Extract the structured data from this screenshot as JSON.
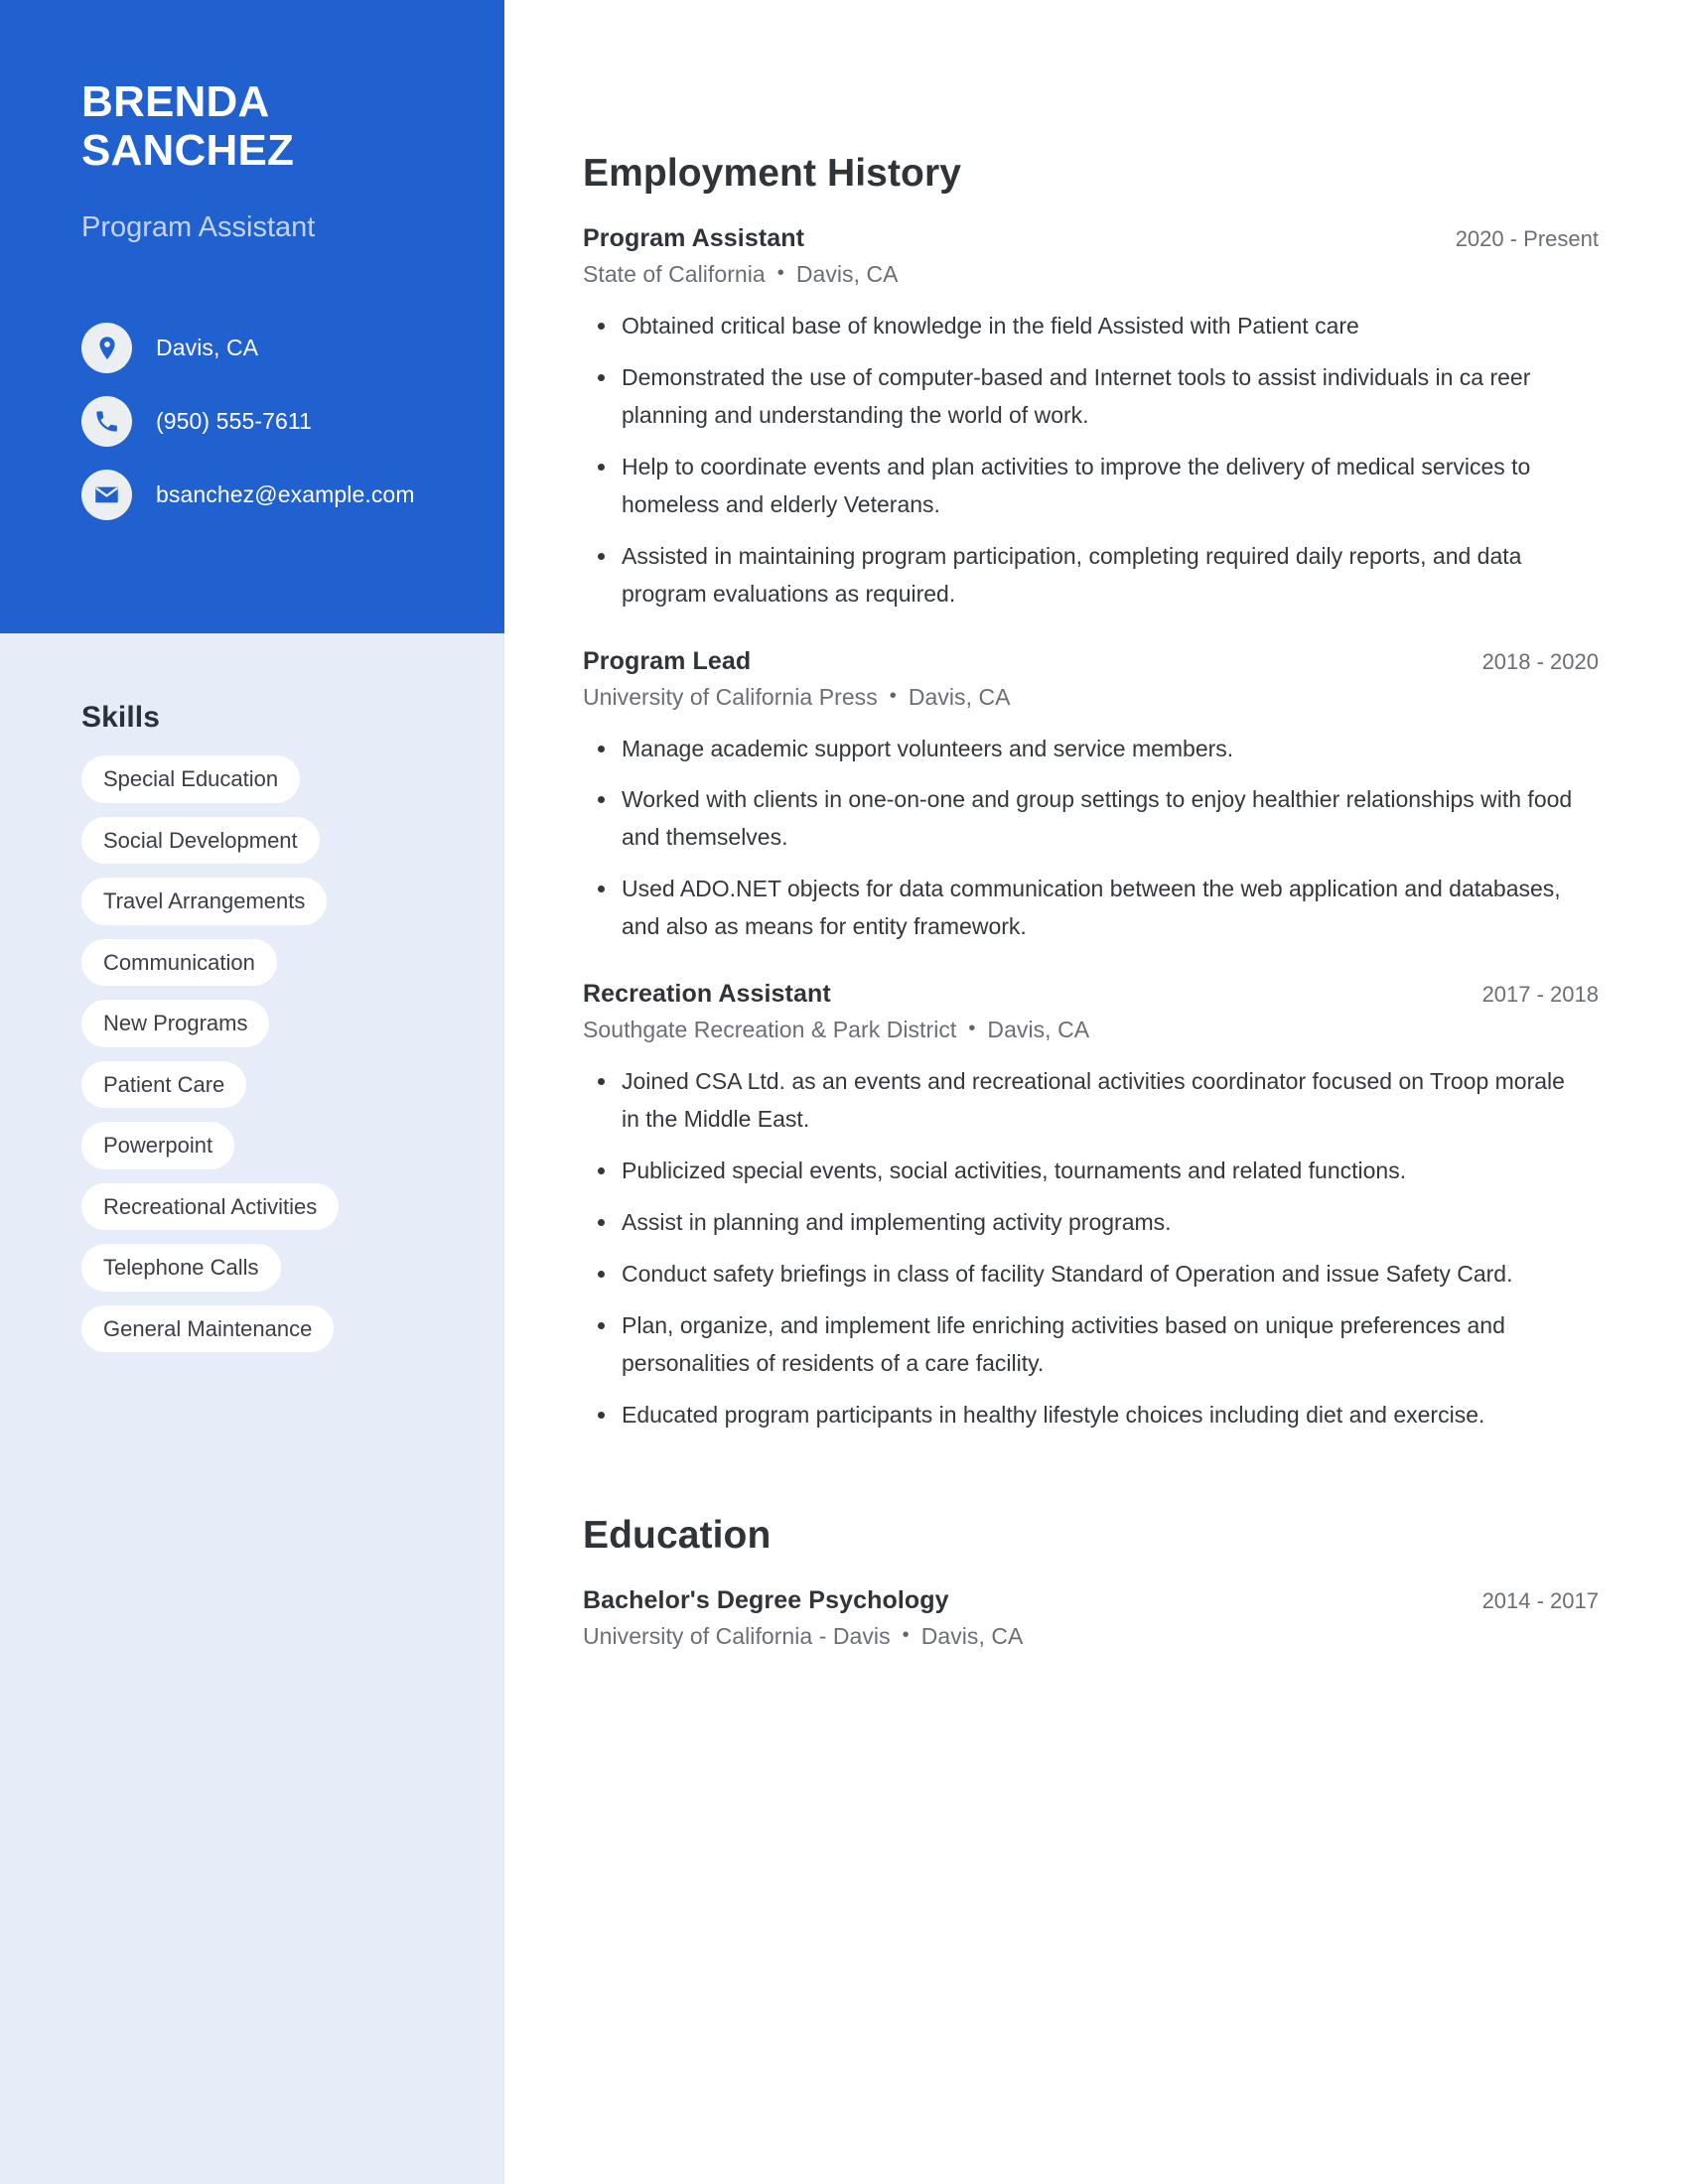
{
  "theme": {
    "accent": "#2160cf",
    "sidebar_bg": "#e7edf8",
    "pill_bg": "#ffffff",
    "heading_color": "#2f3439",
    "muted_text": "#6a6f75"
  },
  "profile": {
    "first_name": "BRENDA",
    "last_name": "SANCHEZ",
    "job_title": "Program Assistant"
  },
  "contact": [
    {
      "icon": "location-pin-icon",
      "value": "Davis, CA"
    },
    {
      "icon": "phone-icon",
      "value": "(950) 555-7611"
    },
    {
      "icon": "envelope-icon",
      "value": "bsanchez@example.com"
    }
  ],
  "skills": {
    "heading": "Skills",
    "items": [
      "Special Education",
      "Social Development",
      "Travel Arrangements",
      "Communication",
      "New Programs",
      "Patient Care",
      "Powerpoint",
      "Recreational Activities",
      "Telephone Calls",
      "General Maintenance"
    ]
  },
  "employment": {
    "heading": "Employment History",
    "separator": "•",
    "jobs": [
      {
        "title": "Program Assistant",
        "dates": "2020 - Present",
        "company": "State of California",
        "location": "Davis, CA",
        "bullets": [
          "Obtained critical base of knowledge in the field Assisted with Patient care",
          "Demonstrated the use of computer-based and Internet tools to assist individuals in ca reer planning and understanding the world of work.",
          "Help to coordinate events and plan activities to improve the delivery of medical services to homeless and elderly Veterans.",
          "Assisted in maintaining program participation, completing required daily reports, and data program evaluations as required."
        ]
      },
      {
        "title": "Program Lead",
        "dates": "2018 - 2020",
        "company": "University of California Press",
        "location": "Davis, CA",
        "bullets": [
          "Manage academic support volunteers and service members.",
          "Worked with clients in one-on-one and group settings to enjoy healthier relationships with food and themselves.",
          "Used ADO.NET objects for data communication between the web application and databases, and also as means for entity framework."
        ]
      },
      {
        "title": "Recreation Assistant",
        "dates": "2017 - 2018",
        "company": "Southgate Recreation & Park District",
        "location": "Davis, CA",
        "bullets": [
          "Joined CSA Ltd. as an events and recreational activities coordinator focused on Troop morale in the Middle East.",
          "Publicized special events, social activities, tournaments and related functions.",
          "Assist in planning and implementing activity programs.",
          "Conduct safety briefings in class of facility Standard of Operation and issue Safety Card.",
          "Plan, organize, and implement life enriching activities based on unique preferences and personalities of residents of a care facility.",
          "Educated program participants in healthy lifestyle choices including diet and exercise."
        ]
      }
    ]
  },
  "education": {
    "heading": "Education",
    "separator": "•",
    "entries": [
      {
        "degree": "Bachelor's Degree Psychology",
        "dates": "2014 - 2017",
        "school": "University of California - Davis",
        "location": "Davis, CA"
      }
    ]
  }
}
